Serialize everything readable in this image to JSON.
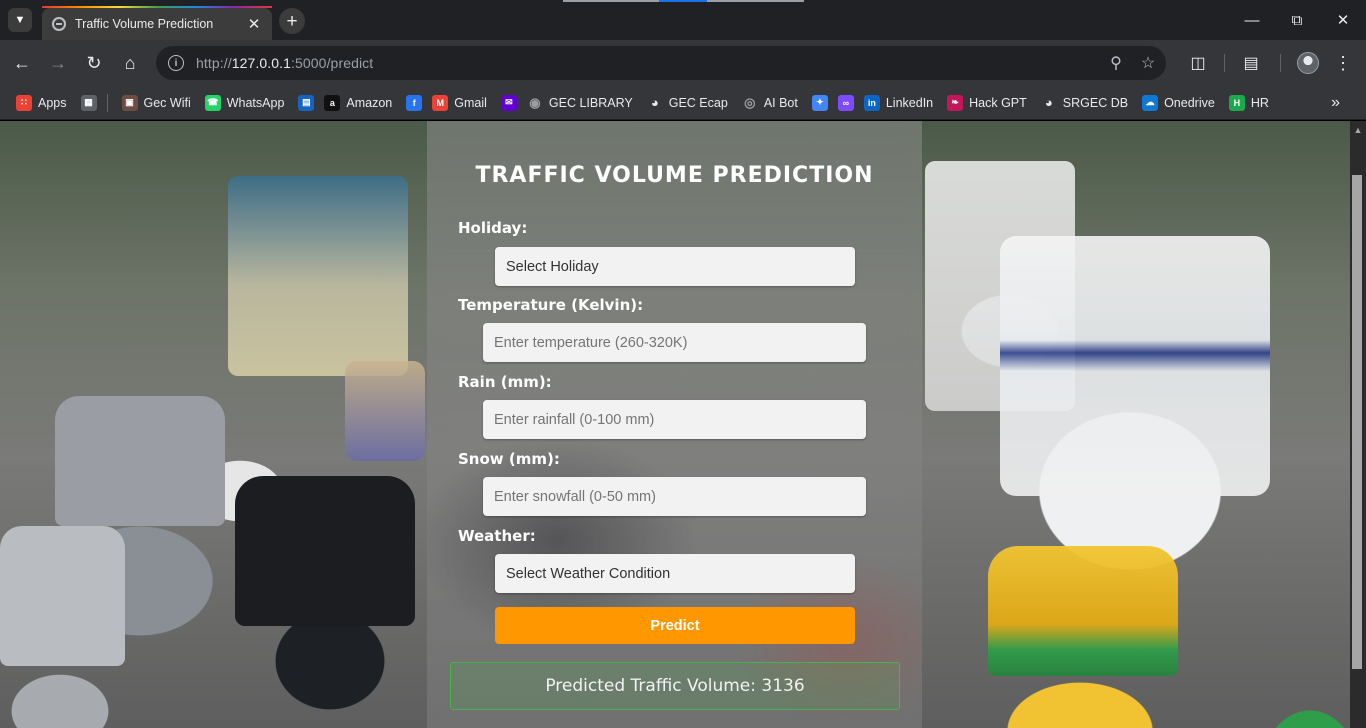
{
  "browser": {
    "tab_title": "Traffic Volume Prediction",
    "url_prefix": "http://",
    "url_host": "127.0.0.1",
    "url_rest": ":5000/predict",
    "bookmarks": [
      {
        "label": "Apps",
        "icon": "apps-grid-icon",
        "color": "#ea4335"
      },
      {
        "label": "",
        "icon": "grid-icon",
        "color": "#5f6368"
      },
      {
        "label": "Gec Wifi",
        "icon": "gec-wifi-icon",
        "color": "#6d4c41"
      },
      {
        "label": "WhatsApp",
        "icon": "whatsapp-icon",
        "color": "#25d366"
      },
      {
        "label": "",
        "icon": "sbi-icon",
        "color": "#1565c0"
      },
      {
        "label": "Amazon",
        "icon": "amazon-icon",
        "color": "#111111"
      },
      {
        "label": "",
        "icon": "flipkart-icon",
        "color": "#2874f0"
      },
      {
        "label": "Gmail",
        "icon": "gmail-icon",
        "color": "#ea4335"
      },
      {
        "label": "",
        "icon": "yahoo-mail-icon",
        "color": "#6001d2"
      },
      {
        "label": "GEC LIBRARY",
        "icon": "library-icon",
        "color": "#9e9e9e"
      },
      {
        "label": "GEC Ecap",
        "icon": "globe-icon",
        "color": "#e8eaed"
      },
      {
        "label": "AI Bot",
        "icon": "ai-bot-icon",
        "color": "#9e9e9e"
      },
      {
        "label": "",
        "icon": "gemini-icon",
        "color": "#4285f4"
      },
      {
        "label": "",
        "icon": "copilot-icon",
        "color": "#7c4dff"
      },
      {
        "label": "LinkedIn",
        "icon": "linkedin-icon",
        "color": "#0a66c2"
      },
      {
        "label": "Hack GPT",
        "icon": "hack-gpt-icon",
        "color": "#c2185b"
      },
      {
        "label": "SRGEC DB",
        "icon": "globe-icon",
        "color": "#e8eaed"
      },
      {
        "label": "Onedrive",
        "icon": "onedrive-icon",
        "color": "#0f78d4"
      },
      {
        "label": "HR",
        "icon": "hackerrank-icon",
        "color": "#1ba94c"
      }
    ]
  },
  "form": {
    "title": "TRAFFIC VOLUME PREDICTION",
    "holiday_label": "Holiday:",
    "holiday_value": "Select Holiday",
    "temperature_label": "Temperature (Kelvin):",
    "temperature_placeholder": "Enter temperature (260-320K)",
    "rain_label": "Rain (mm):",
    "rain_placeholder": "Enter rainfall (0-100 mm)",
    "snow_label": "Snow (mm):",
    "snow_placeholder": "Enter snowfall (0-50 mm)",
    "weather_label": "Weather:",
    "weather_value": "Select Weather Condition",
    "predict_label": "Predict",
    "result_text": "Predicted Traffic Volume: 3136",
    "accent_color": "#ff9800",
    "result_border_color": "#4caf50"
  }
}
